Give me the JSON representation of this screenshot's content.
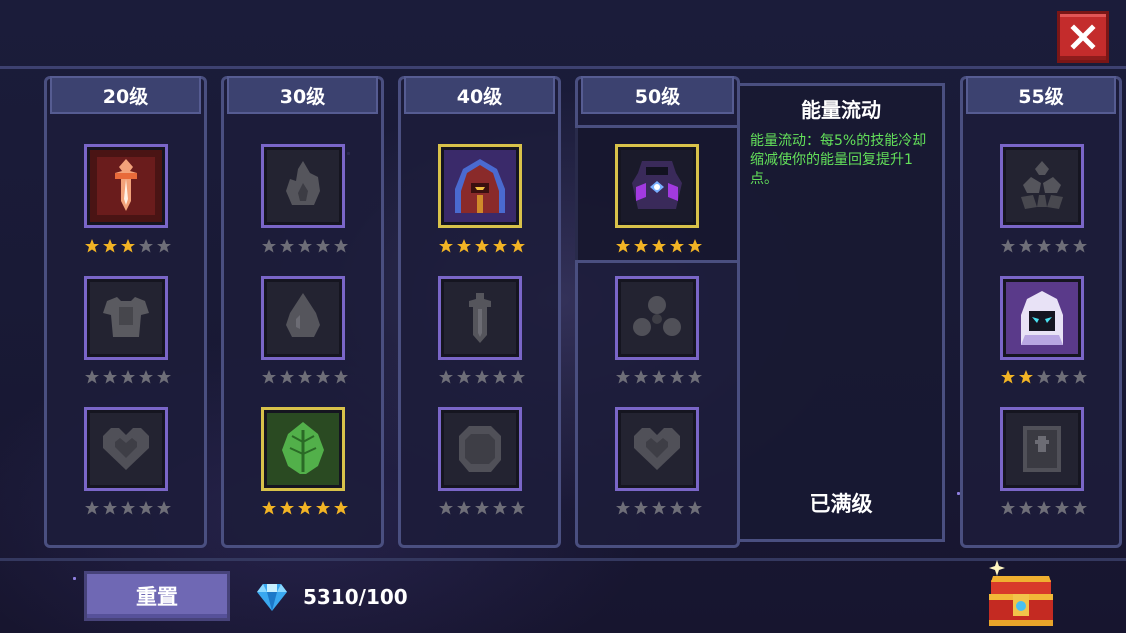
{
  "close": {
    "icon": "close-x-icon"
  },
  "columns": [
    {
      "level": "20级",
      "slots": [
        {
          "icon": "flame-sword-icon",
          "unlocked": true,
          "stars": 3
        },
        {
          "icon": "armor-icon",
          "unlocked": false,
          "stars": 0
        },
        {
          "icon": "heart-icon",
          "unlocked": false,
          "stars": 0
        }
      ]
    },
    {
      "level": "30级",
      "slots": [
        {
          "icon": "fire-icon",
          "unlocked": false,
          "stars": 0
        },
        {
          "icon": "drop-icon",
          "unlocked": false,
          "stars": 0
        },
        {
          "icon": "leaf-icon",
          "unlocked": true,
          "stars": 5,
          "selected_frame": true
        }
      ]
    },
    {
      "level": "40级",
      "slots": [
        {
          "icon": "hooded-mage-icon",
          "unlocked": true,
          "stars": 5,
          "selected_frame": true
        },
        {
          "icon": "sword-icon",
          "unlocked": false,
          "stars": 0
        },
        {
          "icon": "shield-icon",
          "unlocked": false,
          "stars": 0
        }
      ]
    },
    {
      "level": "50级",
      "slots": [
        {
          "icon": "energy-core-icon",
          "unlocked": true,
          "stars": 5,
          "selected_frame": true
        },
        {
          "icon": "orb-triad-icon",
          "unlocked": false,
          "stars": 0
        },
        {
          "icon": "heart-icon",
          "unlocked": false,
          "stars": 0
        }
      ]
    },
    {
      "level": "55级",
      "slots": [
        {
          "icon": "rock-pile-icon",
          "unlocked": false,
          "stars": 0
        },
        {
          "icon": "ghost-icon",
          "unlocked": true,
          "stars": 2
        },
        {
          "icon": "book-icon",
          "unlocked": false,
          "stars": 0
        }
      ]
    }
  ],
  "detail": {
    "title": "能量流动",
    "description": "能量流动：每5%的技能冷却缩减使你的能量回复提升1点。",
    "status": "已满级"
  },
  "footer": {
    "reset_label": "重置",
    "gem_icon": "diamond-gem-icon",
    "gem_count": "5310/100",
    "chest_icon": "treasure-chest-icon"
  },
  "colors": {
    "star_gold": "#f2b425",
    "star_gray": "#6e6e78",
    "frame_purple": "#7a66c8",
    "frame_gold": "#d8c24a",
    "description_green": "#63e05a",
    "close_red": "#c42c2c"
  }
}
